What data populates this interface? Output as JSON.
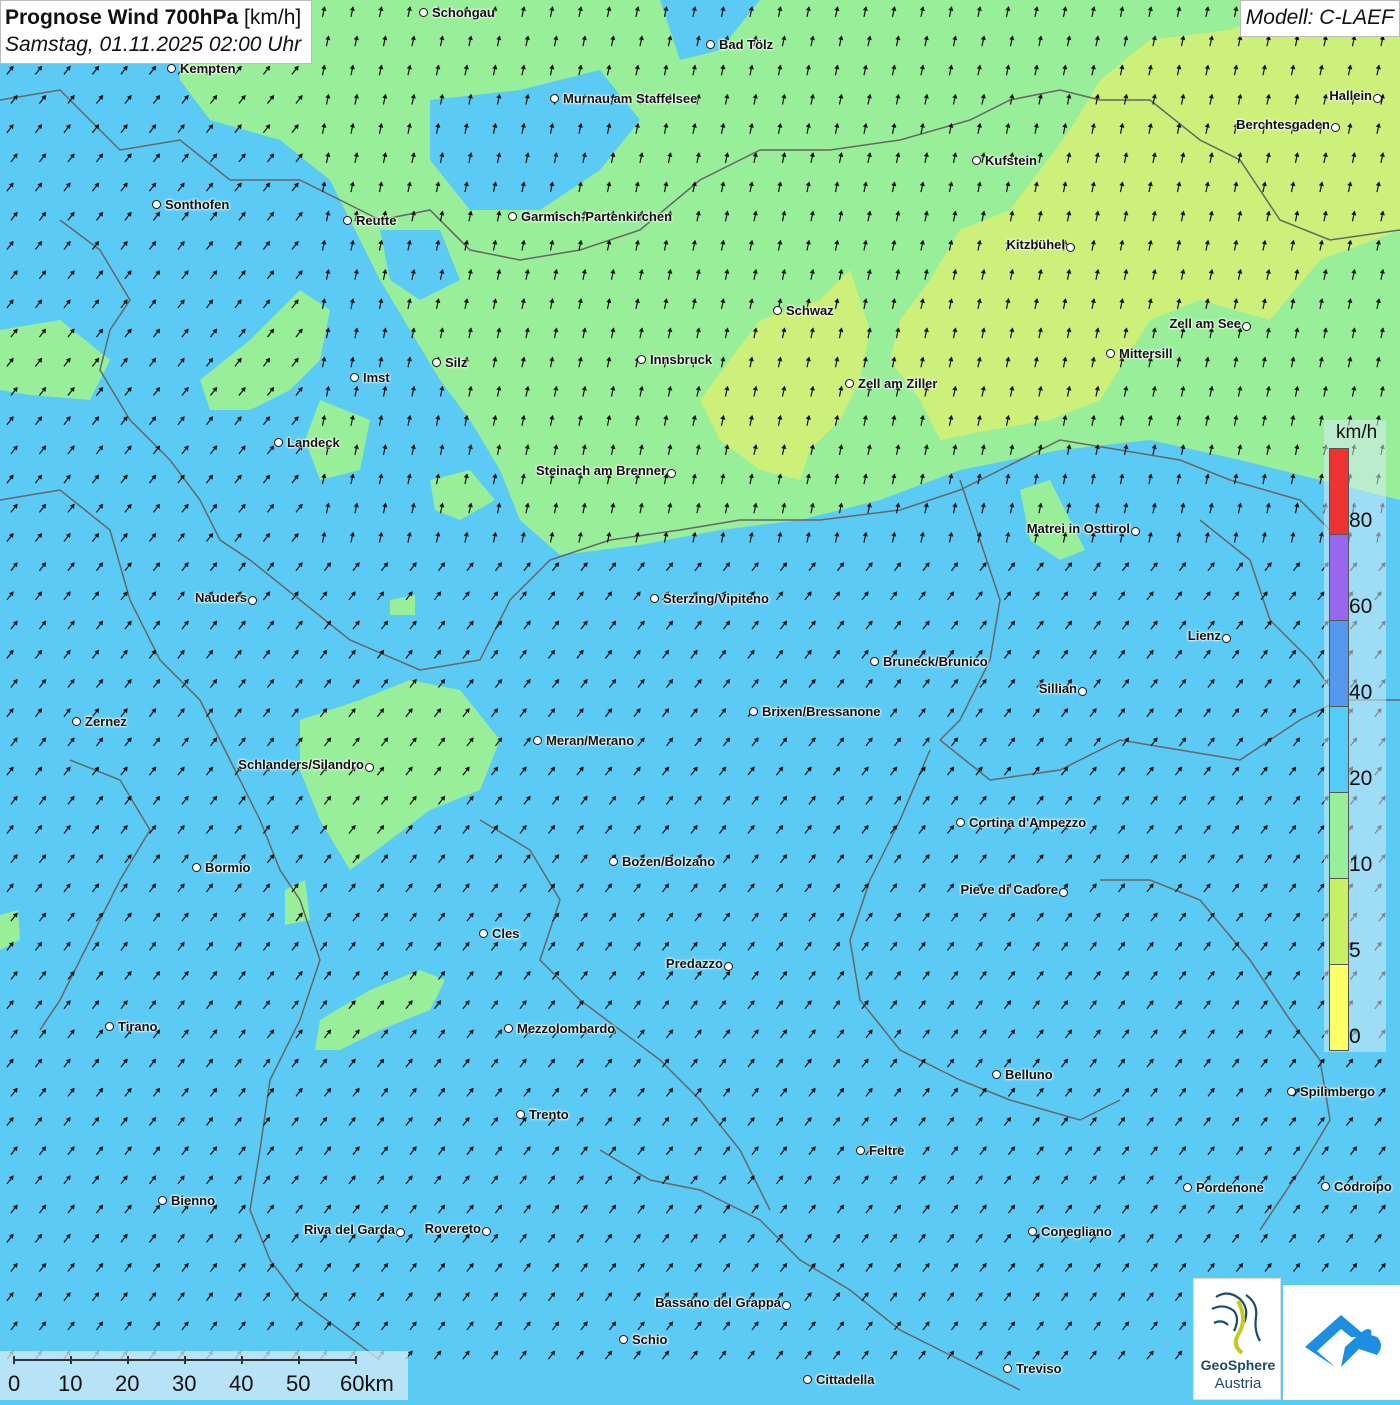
{
  "title": {
    "bold": "Prognose Wind 700hPa",
    "unit": "[km/h]",
    "datetime": "Samstag, 01.11.2025 02:00 Uhr"
  },
  "model": "Modell: C-LAEF",
  "legend": {
    "unit": "km/h",
    "ticks": [
      "0",
      "5",
      "10",
      "20",
      "40",
      "60",
      "80"
    ],
    "colors": [
      "#ffff66",
      "#c8f064",
      "#99ee99",
      "#55ccf5",
      "#5599ee",
      "#9966ee",
      "#ee3333"
    ]
  },
  "scale_bar": {
    "labels": [
      "0",
      "10",
      "20",
      "30",
      "40",
      "50",
      "60km"
    ]
  },
  "logos": {
    "geosphere_line1": "GeoSphere",
    "geosphere_line2": "Austria"
  },
  "colors": {
    "sea_blue": "#5bcbf5",
    "wind_green": "#99ee99",
    "wind_lime": "#cdf07a",
    "border": "#666666"
  },
  "wind_direction": "southwest",
  "cities": [
    {
      "name": "Schongau",
      "align": "right"
    },
    {
      "name": "Bad Tölz",
      "align": "right"
    },
    {
      "name": "Kempten",
      "align": "right"
    },
    {
      "name": "Murnau am Staffelsee",
      "align": "right"
    },
    {
      "name": "Hallein",
      "align": "left"
    },
    {
      "name": "Berchtesgaden",
      "align": "left"
    },
    {
      "name": "Kufstein",
      "align": "right"
    },
    {
      "name": "Sonthofen",
      "align": "right"
    },
    {
      "name": "Reutte",
      "align": "right"
    },
    {
      "name": "Garmisch-Partenkirchen",
      "align": "right"
    },
    {
      "name": "Kitzbühel",
      "align": "left"
    },
    {
      "name": "Schwaz",
      "align": "right"
    },
    {
      "name": "Zell am See",
      "align": "left"
    },
    {
      "name": "Innsbruck",
      "align": "right"
    },
    {
      "name": "Mittersill",
      "align": "right"
    },
    {
      "name": "Silz",
      "align": "right"
    },
    {
      "name": "Imst",
      "align": "right"
    },
    {
      "name": "Zell am Ziller",
      "align": "right"
    },
    {
      "name": "Landeck",
      "align": "right"
    },
    {
      "name": "Steinach am Brenner",
      "align": "left"
    },
    {
      "name": "Matrei in Osttirol",
      "align": "left"
    },
    {
      "name": "Nauders",
      "align": "left"
    },
    {
      "name": "Sterzing/Vipiteno",
      "align": "right"
    },
    {
      "name": "Lienz",
      "align": "left"
    },
    {
      "name": "Bruneck/Brunico",
      "align": "right"
    },
    {
      "name": "Sillian",
      "align": "left"
    },
    {
      "name": "Brixen/Bressanone",
      "align": "right"
    },
    {
      "name": "Zernez",
      "align": "right"
    },
    {
      "name": "Meran/Merano",
      "align": "right"
    },
    {
      "name": "Schlanders/Silandro",
      "align": "left"
    },
    {
      "name": "Cortina d'Ampezzo",
      "align": "right"
    },
    {
      "name": "Bozen/Bolzano",
      "align": "right"
    },
    {
      "name": "Bormio",
      "align": "right"
    },
    {
      "name": "Pieve di Cadore",
      "align": "left"
    },
    {
      "name": "Cles",
      "align": "right"
    },
    {
      "name": "Predazzo",
      "align": "left"
    },
    {
      "name": "Tirano",
      "align": "right"
    },
    {
      "name": "Mezzolombardo",
      "align": "right"
    },
    {
      "name": "Belluno",
      "align": "right"
    },
    {
      "name": "Spilimbergo",
      "align": "right"
    },
    {
      "name": "Trento",
      "align": "right"
    },
    {
      "name": "Feltre",
      "align": "right"
    },
    {
      "name": "Pordenone",
      "align": "right"
    },
    {
      "name": "Codroipo",
      "align": "right"
    },
    {
      "name": "Bienno",
      "align": "right"
    },
    {
      "name": "Riva del Garda",
      "align": "left"
    },
    {
      "name": "Rovereto",
      "align": "left"
    },
    {
      "name": "Conegliano",
      "align": "right"
    },
    {
      "name": "Bassano del Grappa",
      "align": "left"
    },
    {
      "name": "Schio",
      "align": "right"
    },
    {
      "name": "Treviso",
      "align": "right"
    },
    {
      "name": "Cittadella",
      "align": "right"
    }
  ]
}
